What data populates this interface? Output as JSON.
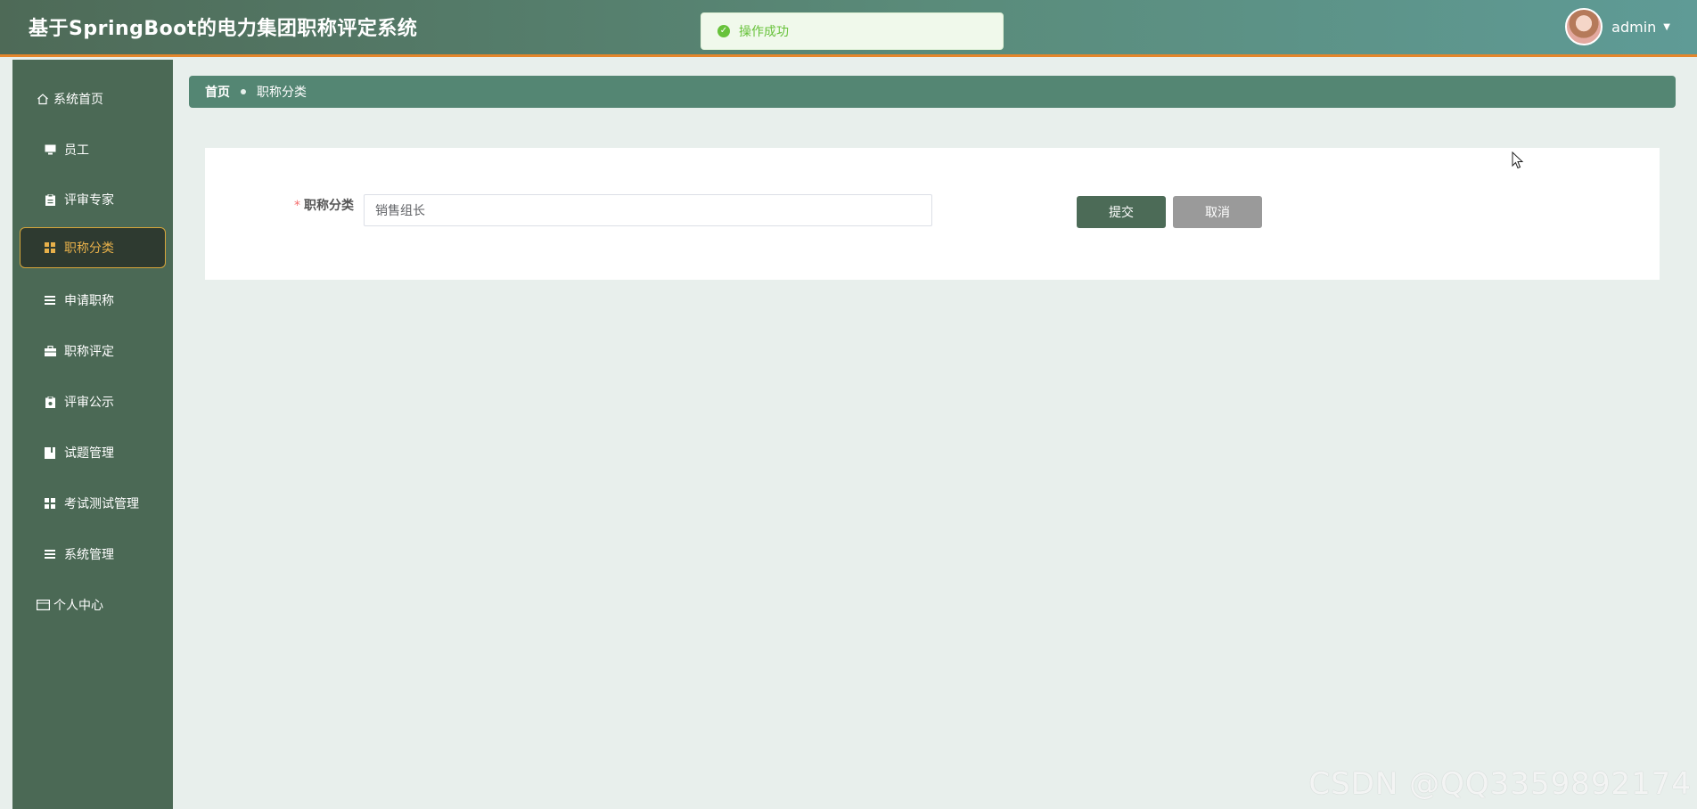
{
  "header": {
    "title": "基于SpringBoot的电力集团职称评定系统",
    "toast_message": "操作成功",
    "username": "admin"
  },
  "sidebar": {
    "items": [
      {
        "label": "系统首页",
        "icon": "home-icon"
      },
      {
        "label": "员工",
        "icon": "monitor-icon"
      },
      {
        "label": "评审专家",
        "icon": "clipboard-icon"
      },
      {
        "label": "职称分类",
        "icon": "grid-icon"
      },
      {
        "label": "申请职称",
        "icon": "list-icon"
      },
      {
        "label": "职称评定",
        "icon": "briefcase-icon"
      },
      {
        "label": "评审公示",
        "icon": "clipboard-icon"
      },
      {
        "label": "试题管理",
        "icon": "book-icon"
      },
      {
        "label": "考试测试管理",
        "icon": "grid-icon"
      },
      {
        "label": "系统管理",
        "icon": "list-icon"
      },
      {
        "label": "个人中心",
        "icon": "card-icon"
      }
    ],
    "active_index": 3
  },
  "breadcrumb": {
    "home": "首页",
    "current": "职称分类"
  },
  "form": {
    "field_label": "职称分类",
    "field_value": "销售组长",
    "submit_label": "提交",
    "cancel_label": "取消"
  },
  "watermark": "CSDN @QQ3359892174",
  "colors": {
    "accent_orange": "#e5862b",
    "sidebar_bg": "#4b6955",
    "active_text": "#e7b04a",
    "success": "#67c23a"
  }
}
